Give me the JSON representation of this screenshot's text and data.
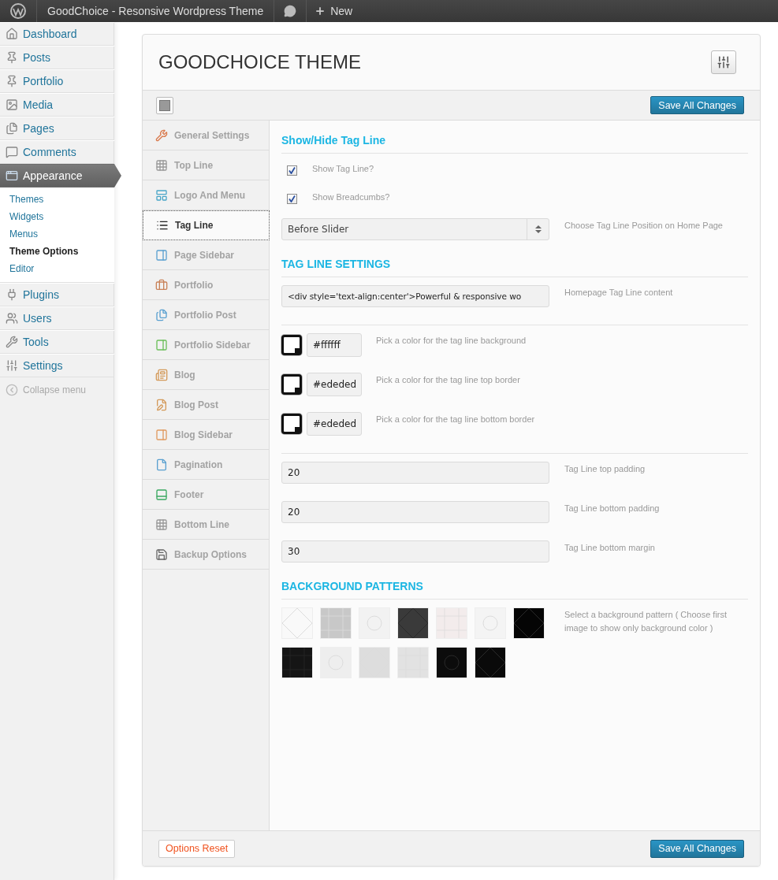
{
  "admin_bar": {
    "site_title": "GoodChoice - Resonsive Wordpress Theme",
    "new_label": "New"
  },
  "admin_menu": [
    {
      "label": "Dashboard",
      "current": false
    },
    {
      "label": "Posts",
      "current": false
    },
    {
      "label": "Portfolio",
      "current": false
    },
    {
      "label": "Media",
      "current": false
    },
    {
      "label": "Pages",
      "current": false
    },
    {
      "label": "Comments",
      "current": false
    },
    {
      "label": "Appearance",
      "current": true,
      "children": [
        {
          "label": "Themes",
          "selected": false
        },
        {
          "label": "Widgets",
          "selected": false
        },
        {
          "label": "Menus",
          "selected": false
        },
        {
          "label": "Theme Options",
          "selected": true
        },
        {
          "label": "Editor",
          "selected": false
        }
      ]
    },
    {
      "label": "Plugins",
      "current": false
    },
    {
      "label": "Users",
      "current": false
    },
    {
      "label": "Tools",
      "current": false
    },
    {
      "label": "Settings",
      "current": false
    }
  ],
  "collapse_label": "Collapse menu",
  "panel": {
    "title": "GOODCHOICE THEME",
    "save_label": "Save All Changes",
    "reset_label": "Options Reset",
    "footer_save_label": "Save All Changes",
    "nav": [
      {
        "label": "General Settings",
        "selected": false
      },
      {
        "label": "Top Line",
        "selected": false
      },
      {
        "label": "Logo And Menu",
        "selected": false
      },
      {
        "label": "Tag Line",
        "selected": true
      },
      {
        "label": "Page Sidebar",
        "selected": false
      },
      {
        "label": "Portfolio",
        "selected": false
      },
      {
        "label": "Portfolio Post",
        "selected": false
      },
      {
        "label": "Portfolio Sidebar",
        "selected": false
      },
      {
        "label": "Blog",
        "selected": false
      },
      {
        "label": "Blog Post",
        "selected": false
      },
      {
        "label": "Blog Sidebar",
        "selected": false
      },
      {
        "label": "Pagination",
        "selected": false
      },
      {
        "label": "Footer",
        "selected": false
      },
      {
        "label": "Bottom Line",
        "selected": false
      },
      {
        "label": "Backup Options",
        "selected": false
      }
    ],
    "fields": [
      {
        "kind": "heading",
        "text": "Show/Hide Tag Line"
      },
      {
        "kind": "checkbox",
        "label": "Show Tag Line?",
        "checked": true
      },
      {
        "kind": "checkbox",
        "label": "Show Breadcumbs?",
        "checked": true
      },
      {
        "kind": "select",
        "value": "Before Slider",
        "description": "Choose Tag Line Position on Home Page"
      },
      {
        "kind": "heading",
        "text": "TAG LINE SETTINGS"
      },
      {
        "kind": "text",
        "value": "<div style='text-align:center'>Powerful & responsive wo",
        "description": "Homepage Tag Line content"
      },
      {
        "kind": "rule"
      },
      {
        "kind": "color",
        "value": "#ffffff",
        "description": "Pick a color for the tag line background"
      },
      {
        "kind": "color",
        "value": "#ededed",
        "description": "Pick a color for the tag line top border"
      },
      {
        "kind": "color",
        "value": "#ededed",
        "description": "Pick a color for the tag line bottom border"
      },
      {
        "kind": "rule"
      },
      {
        "kind": "text",
        "value": "20",
        "description": "Tag Line top padding"
      },
      {
        "kind": "text",
        "value": "20",
        "description": "Tag Line bottom padding"
      },
      {
        "kind": "text",
        "value": "30",
        "description": "Tag Line bottom margin"
      },
      {
        "kind": "heading",
        "text": "BACKGROUND PATTERNS"
      },
      {
        "kind": "patterns",
        "description": "Select a background pattern ( Choose first image to show only background color )",
        "items": [
          {
            "color": "#f9f9f9"
          },
          {
            "color": "#c8c8c8"
          },
          {
            "color": "#f2f2f2"
          },
          {
            "color": "#3a3a3a"
          },
          {
            "color": "#f3ecec"
          },
          {
            "color": "#f4f4f4"
          },
          {
            "color": "#050505"
          },
          {
            "color": "#151515"
          },
          {
            "color": "#eeeeee"
          },
          {
            "color": "#dddddd"
          },
          {
            "color": "#e2e2e2"
          },
          {
            "color": "#0c0c0c"
          },
          {
            "color": "#0a0a0a"
          }
        ]
      }
    ]
  }
}
